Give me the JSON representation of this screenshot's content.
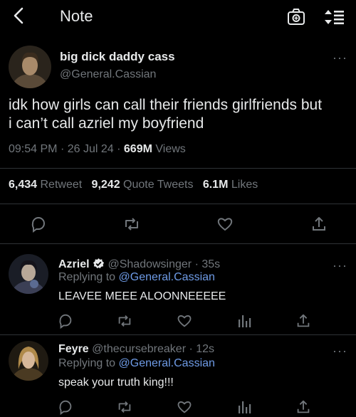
{
  "header": {
    "title": "Note"
  },
  "main_tweet": {
    "display_name": "big dick daddy cass",
    "handle": "@General.Cassian",
    "text_line1": "idk how girls can call their friends girlfriends but",
    "text_line2": "i can’t call azriel my boyfriend",
    "time": "09:54 PM",
    "date": "26 Jul 24",
    "sep": "·",
    "views_count": "669M",
    "views_label": "Views",
    "stats": {
      "retweets_count": "6,434",
      "retweets_label": "Retweet",
      "quotes_count": "9,242",
      "quotes_label": "Quote Tweets",
      "likes_count": "6.1M",
      "likes_label": "Likes"
    }
  },
  "replies": [
    {
      "display_name": "Azriel",
      "verified": true,
      "handle": "@Shadowsinger",
      "time": "· 35s",
      "replying_prefix": "Replying to",
      "replying_to": "@General.Cassian",
      "text": "LEAVEE MEEE ALOONNEEEEE"
    },
    {
      "display_name": "Feyre",
      "verified": false,
      "handle": "@thecursebreaker",
      "time": "· 12s",
      "replying_prefix": "Replying to",
      "replying_to": "@General.Cassian",
      "text": "speak your truth king!!!"
    }
  ],
  "icons": [
    "back-arrow-icon",
    "camera-icon",
    "sort-icon",
    "more-icon",
    "reply-icon",
    "retweet-icon",
    "like-icon",
    "share-icon",
    "analytics-icon",
    "verified-badge-icon"
  ],
  "colors": {
    "background": "#000000",
    "text": "#e7e9ea",
    "muted": "#71767b",
    "link": "#6e9be6",
    "divider": "#2f3336"
  }
}
